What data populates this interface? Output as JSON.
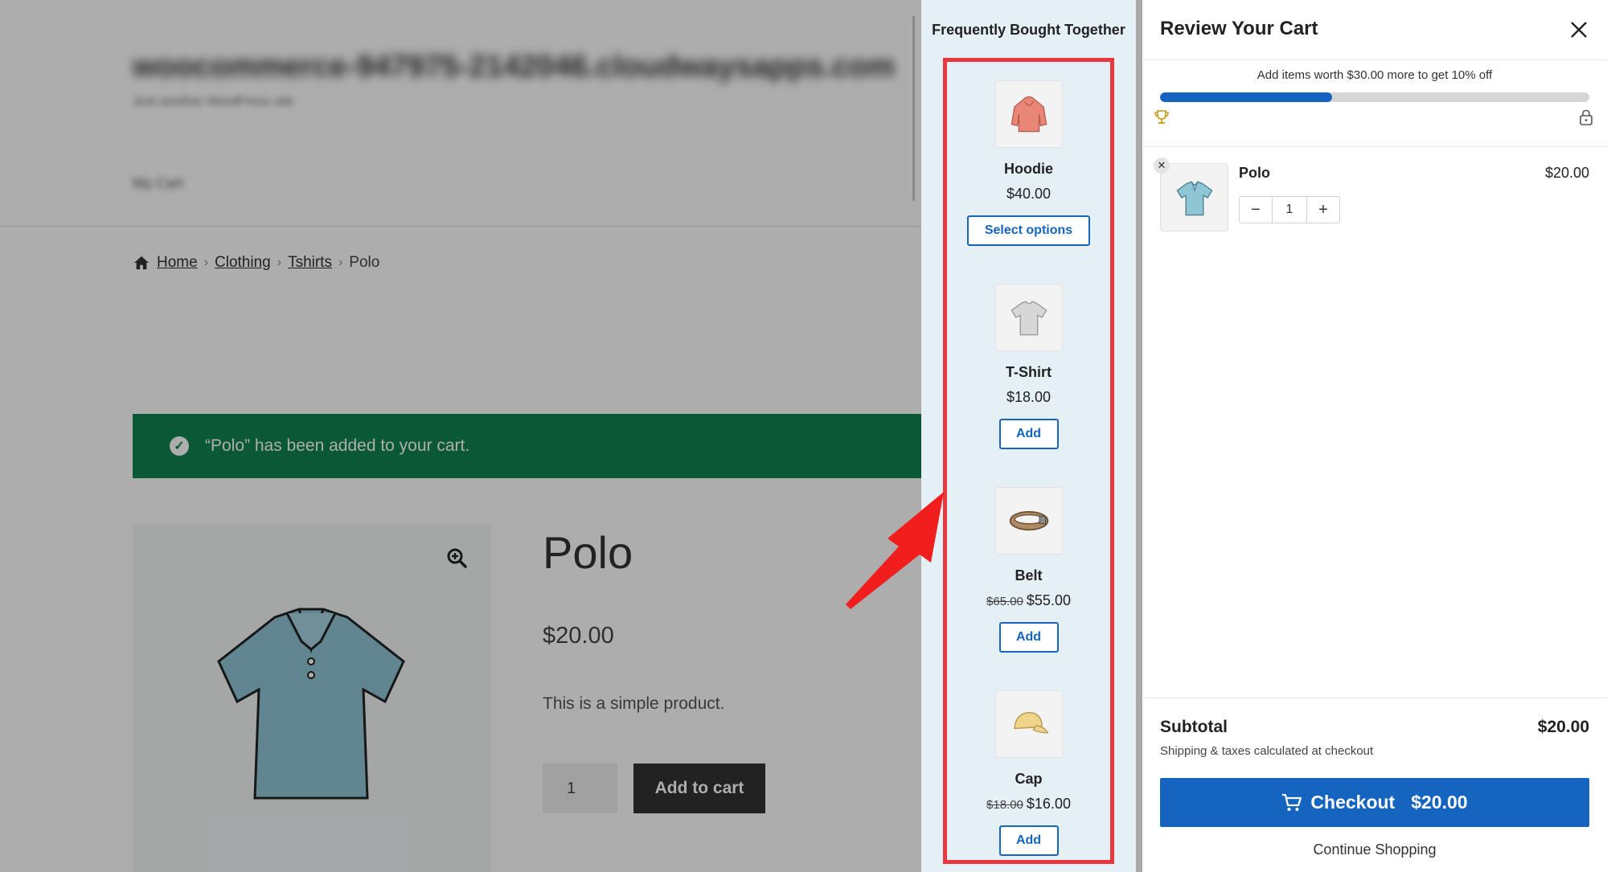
{
  "store": {
    "site_title": "woocommerce-947975-2142046.cloudwaysapps.com",
    "site_tagline": "Just another WordPress site",
    "nav_label": "My Cart",
    "breadcrumb": [
      "Home",
      "Clothing",
      "Tshirts",
      "Polo"
    ],
    "notice": "“Polo” has been added to your cart.",
    "product": {
      "title": "Polo",
      "price": "$20.00",
      "description": "This is a simple product.",
      "quantity": "1",
      "add_to_cart": "Add to cart"
    }
  },
  "fbt": {
    "title": "Frequently Bought Together",
    "items": [
      {
        "name": "Hoodie",
        "price": "$40.00",
        "old_price": "",
        "button": "Select options",
        "icon": "hoodie-icon",
        "color": "#e98677"
      },
      {
        "name": "T-Shirt",
        "price": "$18.00",
        "old_price": "",
        "button": "Add",
        "icon": "tshirt-icon",
        "color": "#d7d7d7"
      },
      {
        "name": "Belt",
        "price": "$55.00",
        "old_price": "$65.00",
        "button": "Add",
        "icon": "belt-icon",
        "color": "#b08a62"
      },
      {
        "name": "Cap",
        "price": "$16.00",
        "old_price": "$18.00",
        "button": "Add",
        "icon": "cap-icon",
        "color": "#f1d48a"
      }
    ],
    "highlight_color": "#e8383d"
  },
  "cart": {
    "title": "Review Your Cart",
    "progress_text": "Add items worth $30.00 more to get 10% off",
    "progress_fraction": 0.4,
    "item": {
      "name": "Polo",
      "price": "$20.00",
      "quantity": "1"
    },
    "subtotal_label": "Subtotal",
    "subtotal_value": "$20.00",
    "shipping_note": "Shipping & taxes calculated at checkout",
    "checkout_label": "Checkout",
    "checkout_amount": "$20.00",
    "continue_label": "Continue Shopping",
    "accent": "#1565c0"
  }
}
